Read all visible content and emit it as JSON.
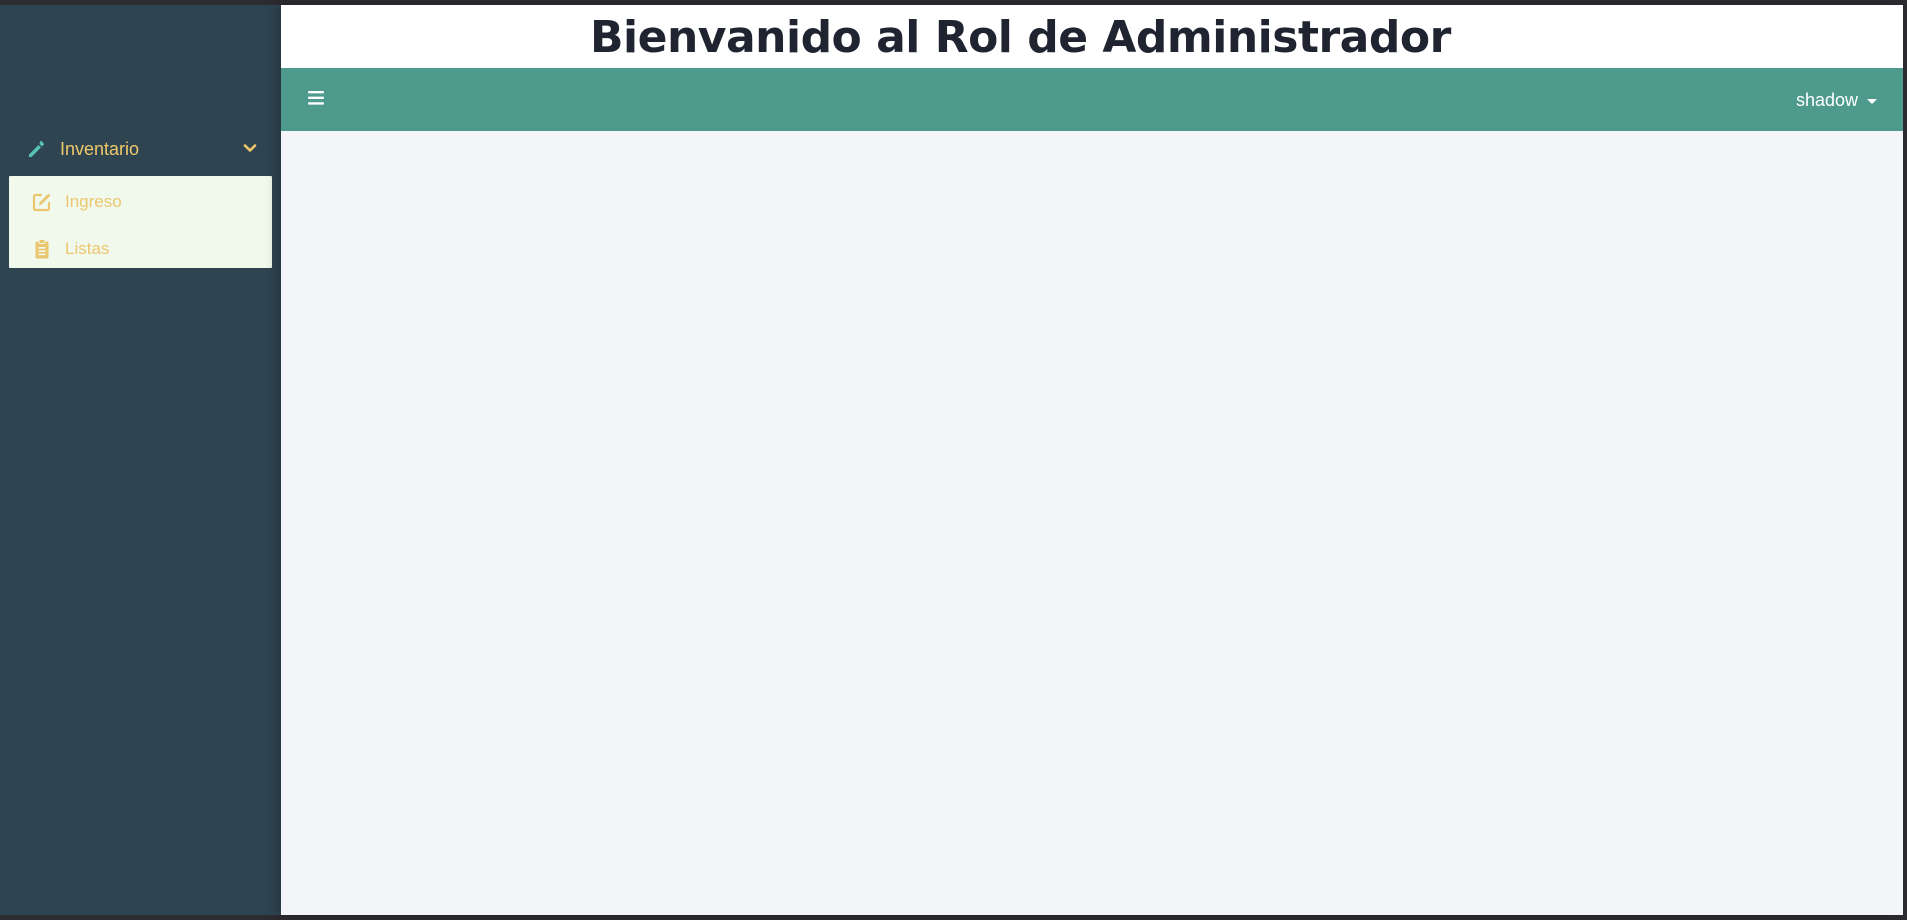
{
  "header": {
    "title": "Bienvanido al Rol de Administrador"
  },
  "topbar": {
    "menu_toggle_icon": "hamburger-icon",
    "user_name": "shadow",
    "user_caret_icon": "caret-down-icon"
  },
  "sidebar": {
    "group": {
      "label": "Inventario",
      "icon": "pencil-icon",
      "chevron_icon": "chevron-down-icon",
      "expanded": true
    },
    "items": [
      {
        "label": "Ingreso",
        "icon": "edit-icon"
      },
      {
        "label": "Listas",
        "icon": "clipboard-icon"
      }
    ]
  },
  "colors": {
    "sidebar_bg": "#2e4551",
    "accent_label": "#efc86a",
    "pencil_icon": "#57c3b6",
    "submenu_bg": "#f0f9ec",
    "topbar_bg": "#4e9b8e",
    "content_bg": "#f3f5f9",
    "title_text": "#1f2430"
  }
}
